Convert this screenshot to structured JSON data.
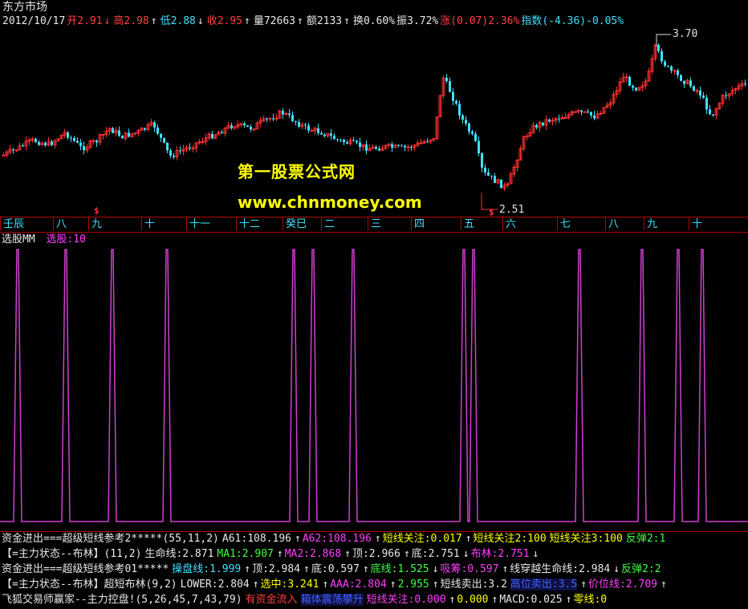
{
  "title": "东方市场",
  "info_bar": [
    {
      "text": "2012/10/17",
      "color": "#e8e8e8"
    },
    {
      "text": "开2.91",
      "color": "#ff4040"
    },
    {
      "text": "↓",
      "color": "#ff4040"
    },
    {
      "text": "高2.98",
      "color": "#ff4040"
    },
    {
      "text": "↑",
      "color": "#e8e8e8"
    },
    {
      "text": "低2.88",
      "color": "#40e0ff"
    },
    {
      "text": "↓",
      "color": "#e8e8e8"
    },
    {
      "text": "收2.95",
      "color": "#ff4040"
    },
    {
      "text": "↑",
      "color": "#e8e8e8"
    },
    {
      "text": "量72663",
      "color": "#e8e8e8"
    },
    {
      "text": "↑",
      "color": "#e8e8e8"
    },
    {
      "text": "额2133",
      "color": "#e8e8e8"
    },
    {
      "text": "↑",
      "color": "#e8e8e8"
    },
    {
      "text": "换0.60%",
      "color": "#e8e8e8"
    },
    {
      "text": "振3.72%",
      "color": "#e8e8e8"
    },
    {
      "text": "涨(0.07)2.36%",
      "color": "#ff4040"
    },
    {
      "text": "指数(-4.36)-0.05%",
      "color": "#40e0ff"
    }
  ],
  "price_high_label": "3.70",
  "price_low_label": "2.51",
  "signal_marks": [
    "$",
    "$"
  ],
  "watermark": {
    "line1": "第一股票公式网",
    "line2": "www.chnmoney.com"
  },
  "axis_labels": [
    {
      "text": "壬辰",
      "color": "#40e0ff"
    },
    {
      "text": "八",
      "color": "#40e0ff"
    },
    {
      "text": "九",
      "color": "#40e0ff"
    },
    {
      "text": "十",
      "color": "#40e0ff"
    },
    {
      "text": "十一",
      "color": "#40e0ff"
    },
    {
      "text": "十二",
      "color": "#40e0ff"
    },
    {
      "text": "癸巳",
      "color": "#40e0ff"
    },
    {
      "text": "二",
      "color": "#40e0ff"
    },
    {
      "text": "三",
      "color": "#40e0ff"
    },
    {
      "text": "四",
      "color": "#40e0ff"
    },
    {
      "text": "五",
      "color": "#40e0ff"
    },
    {
      "text": "六",
      "color": "#40e0ff"
    },
    {
      "text": "七",
      "color": "#40e0ff"
    },
    {
      "text": "八",
      "color": "#40e0ff"
    },
    {
      "text": "九",
      "color": "#40e0ff"
    },
    {
      "text": "十",
      "color": "#40e0ff"
    }
  ],
  "indicator_panel": {
    "name": "选股MM",
    "value_label": "选股:10"
  },
  "spike_signal": {
    "type": "step",
    "series_name": "选股",
    "value_count": 20
  },
  "bottom_rows": [
    [
      {
        "text": "资金进出===超级短线参考2*****(55,11,2)",
        "color": "#e8e8e8"
      },
      {
        "text": "A61:108.196",
        "color": "#e8e8e8"
      },
      {
        "text": "↑",
        "color": "#e8e8e8"
      },
      {
        "text": "A62:108.196",
        "color": "#ff40ff"
      },
      {
        "text": "↑",
        "color": "#e8e8e8"
      },
      {
        "text": "短线关注:0.017",
        "color": "#ffff00"
      },
      {
        "text": "↑",
        "color": "#e8e8e8"
      },
      {
        "text": "短线关注2:100",
        "color": "#ffff00"
      },
      {
        "text": "短线关注3:100",
        "color": "#ffff00"
      },
      {
        "text": "反弹2:1",
        "color": "#40ff40"
      }
    ],
    [
      {
        "text": "【=主力状态--布林】(11,2)",
        "color": "#e8e8e8"
      },
      {
        "text": "生命线:2.871",
        "color": "#e8e8e8"
      },
      {
        "text": "MA1:2.907",
        "color": "#40ff40"
      },
      {
        "text": "↑",
        "color": "#e8e8e8"
      },
      {
        "text": "MA2:2.868",
        "color": "#ff40ff"
      },
      {
        "text": "↑",
        "color": "#e8e8e8"
      },
      {
        "text": "顶:2.966",
        "color": "#e8e8e8"
      },
      {
        "text": "↑",
        "color": "#e8e8e8"
      },
      {
        "text": "底:2.751",
        "color": "#e8e8e8"
      },
      {
        "text": "↓",
        "color": "#e8e8e8"
      },
      {
        "text": "布林:2.751",
        "color": "#ff40ff"
      },
      {
        "text": "↓",
        "color": "#e8e8e8"
      }
    ],
    [
      {
        "text": "资金进出===超级短线参考01*****",
        "color": "#e8e8e8"
      },
      {
        "text": "操盘线:1.999",
        "color": "#40e0ff"
      },
      {
        "text": "↑",
        "color": "#e8e8e8"
      },
      {
        "text": "顶:2.984",
        "color": "#e8e8e8"
      },
      {
        "text": "↑",
        "color": "#e8e8e8"
      },
      {
        "text": "底:0.597",
        "color": "#e8e8e8"
      },
      {
        "text": "↑",
        "color": "#e8e8e8"
      },
      {
        "text": "底线:1.525",
        "color": "#40ff40"
      },
      {
        "text": "↓",
        "color": "#e8e8e8"
      },
      {
        "text": "吸筹:0.597",
        "color": "#ff40ff"
      },
      {
        "text": "↑",
        "color": "#e8e8e8"
      },
      {
        "text": "线穿越生命线:2.984",
        "color": "#e8e8e8"
      },
      {
        "text": "↓",
        "color": "#e8e8e8"
      },
      {
        "text": "反弹2:2",
        "color": "#40ff40"
      }
    ],
    [
      {
        "text": "【=主力状态--布林】超短布林(9,2)",
        "color": "#e8e8e8"
      },
      {
        "text": "LOWER:2.804",
        "color": "#e8e8e8"
      },
      {
        "text": "↑",
        "color": "#e8e8e8"
      },
      {
        "text": "选中:3.241",
        "color": "#ffff00"
      },
      {
        "text": "↑",
        "color": "#e8e8e8"
      },
      {
        "text": "AAA:2.804",
        "color": "#ff40ff"
      },
      {
        "text": "↑",
        "color": "#e8e8e8"
      },
      {
        "text": "2.955",
        "color": "#40ff40"
      },
      {
        "text": "↑",
        "color": "#e8e8e8"
      },
      {
        "text": "短线卖出:3.2",
        "color": "#e8e8e8"
      },
      {
        "text": "高位卖出:3.5",
        "color": "#4060ff"
      },
      {
        "text": "↑",
        "color": "#e8e8e8"
      },
      {
        "text": "价位线:2.709",
        "color": "#ff40ff"
      },
      {
        "text": "↑",
        "color": "#e8e8e8"
      }
    ],
    [
      {
        "text": "飞狐交易师赢家--主力控盘!(5,26,45,7,43,79)",
        "color": "#e8e8e8"
      },
      {
        "text": "有资金流入",
        "color": "#ff4040"
      },
      {
        "text": "箱体震荡攀升",
        "color": "#4060ff"
      },
      {
        "text": "短线关注:0.000",
        "color": "#ff40ff"
      },
      {
        "text": "↑",
        "color": "#e8e8e8"
      },
      {
        "text": "0.000",
        "color": "#ffff00"
      },
      {
        "text": "↑",
        "color": "#e8e8e8"
      },
      {
        "text": "MACD:0.025",
        "color": "#e8e8e8"
      },
      {
        "text": "↑",
        "color": "#e8e8e8"
      },
      {
        "text": "零线:0",
        "color": "#ffff00"
      }
    ]
  ],
  "colors": {
    "up": "#ff3030",
    "down": "#40e0ff",
    "spike": "#d040d0",
    "separator": "#b40000"
  }
}
